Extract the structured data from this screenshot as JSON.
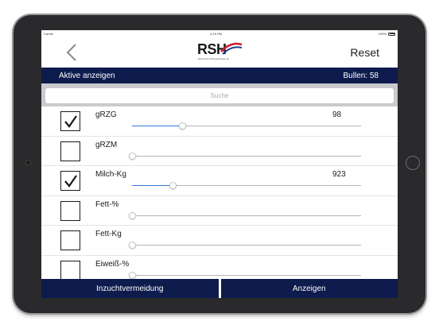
{
  "statusbar": {
    "carrier": "Carrier",
    "time": "4:19 PM",
    "battery": "100%"
  },
  "navbar": {
    "back_icon": "chevron-left-icon",
    "logo_text": "RSH",
    "logo_subtitle": "Rinderzucht Schleswig-Holstein eG",
    "reset_label": "Reset"
  },
  "filterbar": {
    "active_label": "Aktive anzeigen",
    "count_label": "Bullen: 58"
  },
  "search": {
    "placeholder": "Suche"
  },
  "rows": [
    {
      "label": "gRZG",
      "value": "98",
      "checked": true,
      "slider": 0.22
    },
    {
      "label": "gRZM",
      "value": "",
      "checked": false,
      "slider": 0.0
    },
    {
      "label": "Milch-Kg",
      "value": "923",
      "checked": true,
      "slider": 0.18
    },
    {
      "label": "Fett-%",
      "value": "",
      "checked": false,
      "slider": 0.0
    },
    {
      "label": "Fett-Kg",
      "value": "",
      "checked": false,
      "slider": 0.0
    },
    {
      "label": "Eiweiß-%",
      "value": "",
      "checked": false,
      "slider": 0.0
    }
  ],
  "bottombar": {
    "left_label": "Inzuchtvermeidung",
    "right_label": "Anzeigen"
  },
  "colors": {
    "navy": "#0d1b4d",
    "slider_fill": "#3478d4",
    "logo_red": "#d0202f",
    "logo_blue": "#1f3f8f"
  }
}
